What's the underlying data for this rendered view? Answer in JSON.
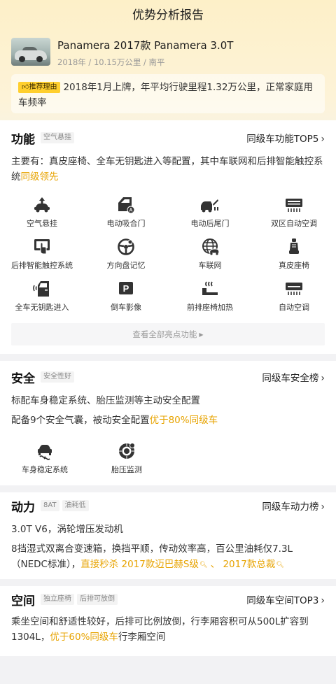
{
  "nav": {
    "title": "优势分析报告"
  },
  "car": {
    "name": "Panamera 2017款 Panamera 3.0T",
    "meta": "2018年 / 10.15万公里 / 南平"
  },
  "reason": {
    "tag": "推荐理由",
    "text": "2018年1月上牌，年平均行驶里程1.32万公里，正常家庭用车频率"
  },
  "features": {
    "title": "功能",
    "badge": "空气悬挂",
    "rank": "同级车功能TOP5",
    "summary_prefix": "主要有：真皮座椅、全车无钥匙进入等配置，其中车联网和后排智能触控系统",
    "summary_highlight": "同级领先",
    "items": [
      {
        "label": "空气悬挂",
        "icon": "air-suspension-icon"
      },
      {
        "label": "电动吸合门",
        "icon": "soft-close-door-icon"
      },
      {
        "label": "电动后尾门",
        "icon": "power-tailgate-icon"
      },
      {
        "label": "双区自动空调",
        "icon": "dual-zone-ac-icon"
      },
      {
        "label": "后排智能触控系统",
        "icon": "rear-touch-control-icon"
      },
      {
        "label": "方向盘记忆",
        "icon": "steering-wheel-memory-icon"
      },
      {
        "label": "车联网",
        "icon": "connected-car-icon"
      },
      {
        "label": "真皮座椅",
        "icon": "leather-seat-icon"
      },
      {
        "label": "全车无钥匙进入",
        "icon": "keyless-entry-icon"
      },
      {
        "label": "倒车影像",
        "icon": "rear-camera-icon"
      },
      {
        "label": "前排座椅加热",
        "icon": "seat-heating-icon"
      },
      {
        "label": "自动空调",
        "icon": "auto-ac-icon"
      }
    ],
    "more_label": "查看全部亮点功能"
  },
  "safety": {
    "title": "安全",
    "badge": "安全性好",
    "rank": "同级车安全榜",
    "line1": "标配车身稳定系统、胎压监测等主动安全配置",
    "line2_prefix": "配备9个安全气囊，被动安全配置",
    "line2_highlight": "优于80%同级车",
    "items": [
      {
        "label": "车身稳定系统",
        "icon": "stability-control-icon"
      },
      {
        "label": "胎压监测",
        "icon": "tire-pressure-icon"
      }
    ]
  },
  "power": {
    "title": "动力",
    "badges": [
      "8AT",
      "油耗低"
    ],
    "rank": "同级车动力榜",
    "line1": "3.0T V6，涡轮增压发动机",
    "line2": "8挡湿式双离合变速箱，换挡平顺，传动效率高，百公里油耗仅7.3L（NEDC标准），",
    "line2_highlight": "直接秒杀",
    "link1": "2017款迈巴赫S级",
    "separator": "、",
    "link2": "2017款总裁"
  },
  "space": {
    "title": "空间",
    "badges": [
      "独立座椅",
      "后排可放倒"
    ],
    "rank": "同级车空间TOP3",
    "text_prefix": "乘坐空间和舒适性较好，后排可比例放倒，行李厢容积可从500L扩容到1304L，",
    "text_highlight": "优于60%同级车",
    "text_suffix": "行李厢空间"
  },
  "colors": {
    "accent": "#e7a300",
    "tag_yellow": "#ffcf2e",
    "header_bg": "#fdf0c8"
  }
}
